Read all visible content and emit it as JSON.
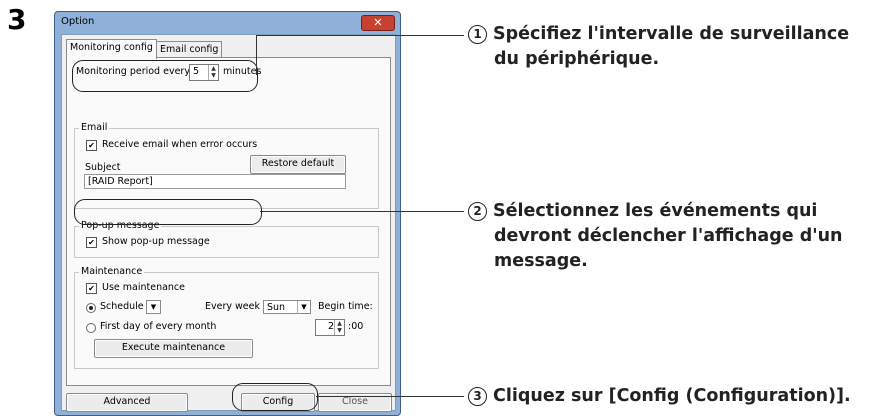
{
  "step_number": "3",
  "window": {
    "title": "Option",
    "close_glyph": "✕"
  },
  "tabs": [
    {
      "label": "Monitoring config",
      "active": true
    },
    {
      "label": "Email config",
      "active": false
    }
  ],
  "monitoring": {
    "prefix": "Monitoring period every",
    "value": "5",
    "suffix": "minutes"
  },
  "email": {
    "group_title": "Email",
    "receive_label": "Receive email when error occurs",
    "receive_checked": true,
    "subject_label": "Subject",
    "restore_button": "Restore default",
    "subject_value": "[RAID Report]"
  },
  "popup": {
    "group_title": "Pop-up message",
    "show_label": "Show pop-up message",
    "show_checked": true
  },
  "maintenance": {
    "group_title": "Maintenance",
    "use_label": "Use maintenance",
    "use_checked": true,
    "schedule_label": "Schedule",
    "every_week_label": "Every week",
    "day_value": "Sun",
    "begin_time_label": "Begin time:",
    "first_day_label": "First day of every month",
    "hour_value": "2",
    "minutes_suffix": ":00",
    "execute_button": "Execute maintenance"
  },
  "buttons": {
    "advanced": "Advanced",
    "config": "Config",
    "close": "Close"
  },
  "callouts": [
    {
      "num": "1",
      "line1": "Spécifiez l'intervalle de surveillance",
      "line2": "du périphérique."
    },
    {
      "num": "2",
      "line1": "Sélectionnez les événements qui",
      "line2": "devront déclencher l'affichage d'un",
      "line3": "message."
    },
    {
      "num": "3",
      "line1": "Cliquez sur [Config (Configuration)]."
    }
  ]
}
